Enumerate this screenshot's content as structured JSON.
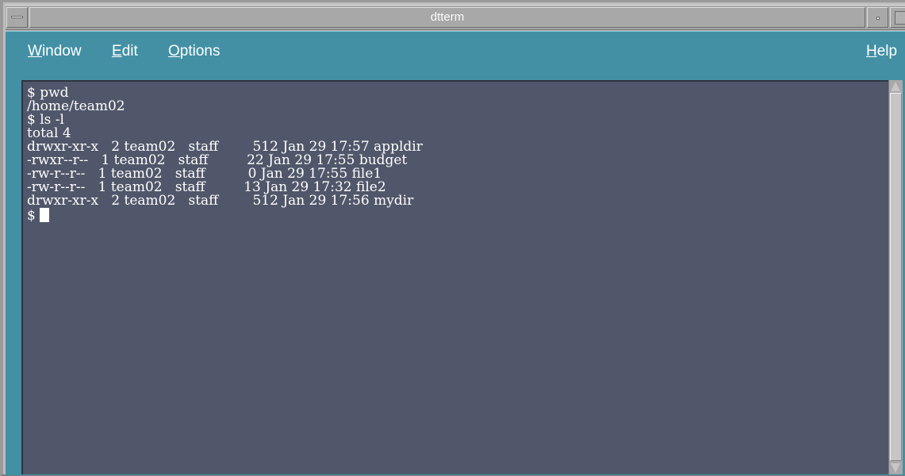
{
  "window": {
    "title": "dtterm"
  },
  "menubar": {
    "items": [
      {
        "mnemonic": "W",
        "rest": "indow"
      },
      {
        "mnemonic": "E",
        "rest": "dit"
      },
      {
        "mnemonic": "O",
        "rest": "ptions"
      },
      {
        "mnemonic": "H",
        "rest": "elp"
      }
    ]
  },
  "terminal": {
    "lines": [
      "$ pwd",
      "/home/team02",
      "$ ls -l",
      "total 4",
      "drwxr-xr-x   2 team02   staff        512 Jan 29 17:57 appldir",
      "-rwxr--r--   1 team02   staff         22 Jan 29 17:55 budget",
      "-rw-r--r--   1 team02   staff          0 Jan 29 17:55 file1",
      "-rw-r--r--   1 team02   staff         13 Jan 29 17:32 file2",
      "drwxr-xr-x   2 team02   staff        512 Jan 29 17:56 mydir"
    ],
    "prompt": "$ "
  },
  "colors": {
    "menubar_bg": "#4390a5",
    "terminal_bg": "#51576a",
    "terminal_fg": "#ffffff"
  }
}
